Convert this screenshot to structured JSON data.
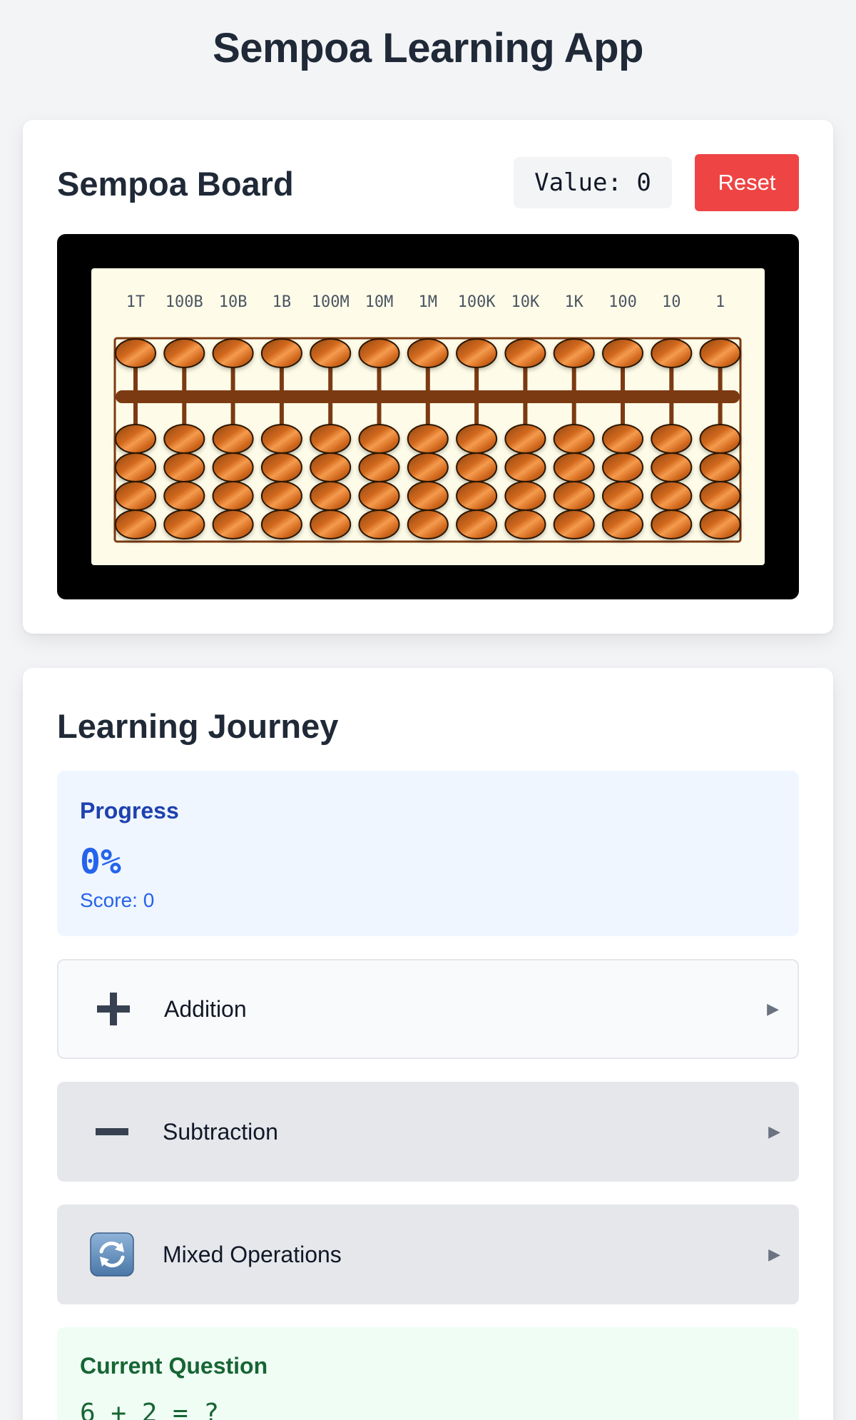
{
  "app": {
    "title": "Sempoa Learning App"
  },
  "board": {
    "title": "Sempoa Board",
    "value_display": "Value: 0",
    "reset_label": "Reset",
    "columns": [
      "1T",
      "100B",
      "10B",
      "1B",
      "100M",
      "10M",
      "1M",
      "100K",
      "10K",
      "1K",
      "100",
      "10",
      "1"
    ],
    "upper_beads_per_rod": 1,
    "lower_beads_per_rod": 4,
    "colors": {
      "frame": "#000000",
      "inner": "#fefce8",
      "rod": "#7c3a12",
      "bead_light": "#f59b4e",
      "bead_mid": "#d2691e",
      "bead_dark": "#8b4513"
    }
  },
  "journey": {
    "title": "Learning Journey",
    "progress": {
      "label": "Progress",
      "percent_text": "0%",
      "score_text": "Score: 0"
    },
    "operations": [
      {
        "label": "Addition",
        "icon": "plus-icon",
        "arrow": "▶",
        "selected": true
      },
      {
        "label": "Subtraction",
        "icon": "minus-icon",
        "arrow": "▶",
        "selected": false
      },
      {
        "label": "Mixed Operations",
        "icon": "refresh-icon",
        "arrow": "▶",
        "selected": false
      }
    ],
    "question": {
      "label": "Current Question",
      "text": "6 + 2 = ?"
    }
  }
}
